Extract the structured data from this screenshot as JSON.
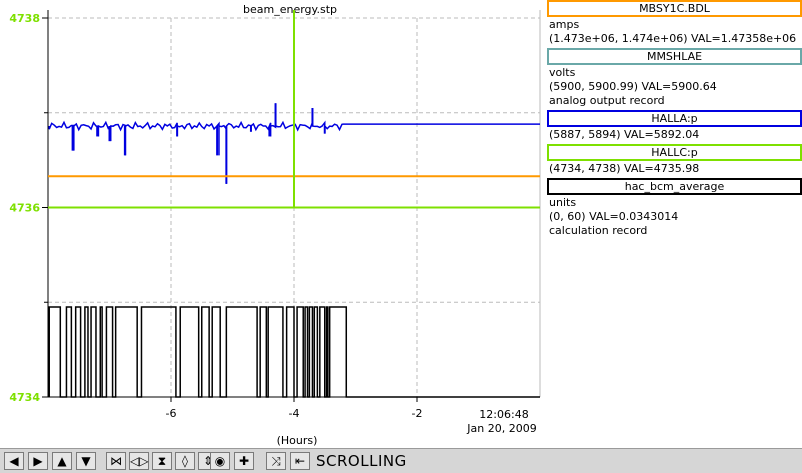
{
  "chart_data": {
    "type": "line",
    "title": "beam_energy.stp",
    "xlabel": "(Hours)",
    "x_ticks": [
      {
        "value": -6,
        "label": "-6"
      },
      {
        "value": -4,
        "label": "-4"
      },
      {
        "value": -2,
        "label": "-2"
      }
    ],
    "time_label_line1": "12:06:48",
    "time_label_line2": "Jan 20, 2009",
    "xlim": [
      -8.0,
      0.0
    ],
    "ylim": [
      4734,
      4738
    ],
    "y_ticks": [
      {
        "value": 4738,
        "label": "4738"
      },
      {
        "value": 4736,
        "label": "4736"
      },
      {
        "value": 4734,
        "label": "4734"
      }
    ],
    "y_minor_ticks": [
      4737,
      4735
    ],
    "y_axis_color": "#7ee000",
    "grid": true,
    "cursor_x": -4.0,
    "series": [
      {
        "name": "HALLA:p",
        "color": "#0000e0",
        "baseline": 4736.86,
        "end_x": -3.2,
        "x_range": [
          -8.0,
          0.0
        ],
        "spikes": [
          {
            "x": -7.6,
            "y": 4736.6
          },
          {
            "x": -7.2,
            "y": 4736.75
          },
          {
            "x": -7.0,
            "y": 4736.7
          },
          {
            "x": -6.75,
            "y": 4736.55
          },
          {
            "x": -5.9,
            "y": 4736.75
          },
          {
            "x": -5.25,
            "y": 4736.55
          },
          {
            "x": -5.1,
            "y": 4736.25
          },
          {
            "x": -4.7,
            "y": 4736.8
          },
          {
            "x": -4.4,
            "y": 4736.75
          },
          {
            "x": -4.3,
            "y": 4737.1
          },
          {
            "x": -3.7,
            "y": 4737.05
          },
          {
            "x": -3.5,
            "y": 4736.78
          }
        ]
      },
      {
        "name": "MBSY1C.BDL",
        "color": "#ff9900",
        "values": [
          4736.33,
          4736.33
        ],
        "x": [
          -8.0,
          0.0
        ]
      },
      {
        "name": "HALLC:p",
        "color": "#7ee000",
        "values": [
          4736.0,
          4736.0
        ],
        "x": [
          -8.0,
          0.0
        ]
      },
      {
        "name": "hac_bcm_average",
        "color": "#000000",
        "low": 4734.0,
        "high": 4734.95,
        "end_x": -3.15,
        "x_range": [
          -8.0,
          0.0
        ],
        "gaps": [
          [
            -7.8,
            -7.7
          ],
          [
            -7.62,
            -7.55
          ],
          [
            -7.47,
            -7.4
          ],
          [
            -7.35,
            -7.3
          ],
          [
            -7.22,
            -7.15
          ],
          [
            -7.12,
            -7.05
          ],
          [
            -6.95,
            -6.9
          ],
          [
            -6.55,
            -6.48
          ],
          [
            -5.92,
            -5.85
          ],
          [
            -5.55,
            -5.5
          ],
          [
            -5.38,
            -5.33
          ],
          [
            -5.2,
            -5.1
          ],
          [
            -4.6,
            -4.55
          ],
          [
            -4.45,
            -4.42
          ],
          [
            -4.18,
            -4.12
          ],
          [
            -4.0,
            -3.95
          ],
          [
            -3.85,
            -3.82
          ],
          [
            -3.78,
            -3.75
          ],
          [
            -3.7,
            -3.67
          ],
          [
            -3.62,
            -3.58
          ],
          [
            -3.5,
            -3.47
          ],
          [
            -3.45,
            -3.42
          ]
        ]
      }
    ]
  },
  "legend": {
    "entries": [
      {
        "title": "MBSY1C.BDL",
        "color": "#ff9900",
        "lines": [
          "amps",
          "(1.473e+06, 1.474e+06)  VAL=1.47358e+06"
        ]
      },
      {
        "title": "MMSHLAE",
        "color": "#6aa8a8",
        "lines": [
          "volts",
          "(5900, 5900.99) VAL=5900.64",
          "analog output record"
        ]
      },
      {
        "title": "HALLA:p",
        "color": "#0000e0",
        "lines": [
          "(5887, 5894) VAL=5892.04"
        ]
      },
      {
        "title": "HALLC:p",
        "color": "#7ee000",
        "lines": [
          "(4734, 4738) VAL=4735.98"
        ]
      },
      {
        "title": "hac_bcm_average",
        "color": "#000000",
        "lines": [
          "units",
          "(0, 60) VAL=0.0343014",
          "calculation record"
        ]
      }
    ]
  },
  "toolbar": {
    "buttons": [
      {
        "name": "pan-left-button",
        "icon": "arrow-left-icon",
        "glyph": "◀"
      },
      {
        "name": "pan-right-button",
        "icon": "arrow-right-icon",
        "glyph": "▶"
      },
      {
        "name": "pan-up-button",
        "icon": "arrow-up-icon",
        "glyph": "▲"
      },
      {
        "name": "pan-down-button",
        "icon": "arrow-down-icon",
        "glyph": "▼"
      },
      {
        "name": "zoom-in-x-button",
        "icon": "zoom-in-x-icon",
        "glyph": "⋈"
      },
      {
        "name": "zoom-out-x-button",
        "icon": "zoom-out-x-icon",
        "glyph": "◁▷"
      },
      {
        "name": "zoom-in-y-button",
        "icon": "zoom-in-y-icon",
        "glyph": "⧗"
      },
      {
        "name": "zoom-out-y-button",
        "icon": "zoom-out-y-icon",
        "glyph": "◊"
      },
      {
        "name": "auto-zoom-button",
        "icon": "auto-zoom-icon",
        "glyph": "⇕"
      },
      {
        "name": "stagger-button",
        "icon": "record-icon",
        "glyph": "◉"
      },
      {
        "name": "add-button",
        "icon": "plus-icon",
        "glyph": "✚"
      },
      {
        "name": "undo-button",
        "icon": "undo-icon",
        "glyph": "⤨"
      },
      {
        "name": "mode-button",
        "icon": "mode-icon",
        "glyph": "⇤"
      }
    ],
    "mode_label": "SCROLLING"
  }
}
